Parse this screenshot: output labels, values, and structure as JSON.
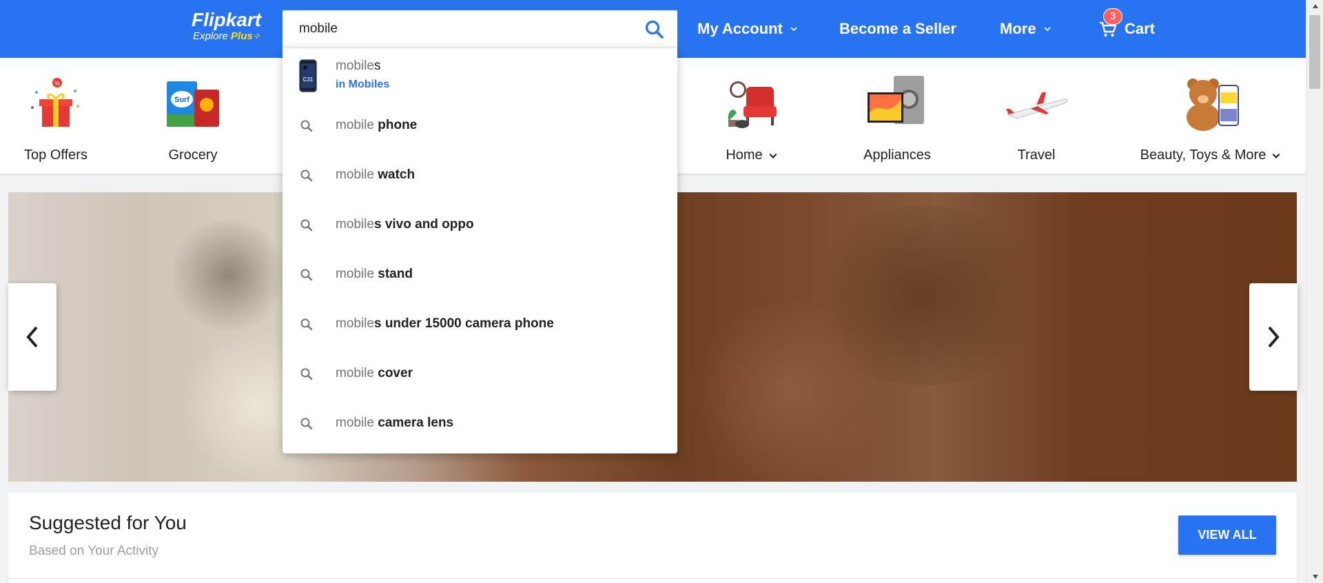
{
  "header": {
    "logo_text": "Flipkart",
    "logo_sub_prefix": "Explore",
    "logo_sub_plus": "Plus",
    "search_value": "mobile",
    "account_label": "My Account",
    "seller_label": "Become a Seller",
    "more_label": "More",
    "cart_label": "Cart",
    "cart_count": "3",
    "brand_color": "#2874f0"
  },
  "categories": [
    {
      "label": "Top Offers",
      "icon": "gift-box-icon"
    },
    {
      "label": "Grocery",
      "icon": "grocery-icon"
    },
    {
      "label": "Home",
      "icon": "home-furniture-icon"
    },
    {
      "label": "Appliances",
      "icon": "appliances-icon"
    },
    {
      "label": "Travel",
      "icon": "airplane-icon"
    },
    {
      "label": "Beauty, Toys & More",
      "icon": "teddy-bear-icon"
    }
  ],
  "dropdown": {
    "first": {
      "typed": "mobile",
      "rest": "s",
      "category": "in Mobiles"
    },
    "suggestions": [
      {
        "typed": "mobile",
        "rest": " phone"
      },
      {
        "typed": "mobile",
        "rest": " watch"
      },
      {
        "typed": "mobile",
        "rest": "s vivo and oppo"
      },
      {
        "typed": "mobile",
        "rest": " stand"
      },
      {
        "typed": "mobile",
        "rest": "s under 15000 camera phone"
      },
      {
        "typed": "mobile",
        "rest": " cover"
      },
      {
        "typed": "mobile",
        "rest": " camera lens"
      }
    ]
  },
  "suggested": {
    "title": "Suggested for You",
    "subtitle": "Based on Your Activity",
    "view_all": "VIEW ALL"
  }
}
